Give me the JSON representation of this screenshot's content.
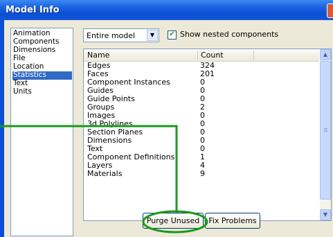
{
  "window": {
    "title": "Model Info"
  },
  "sidebar": {
    "items": [
      {
        "label": "Animation",
        "selected": false
      },
      {
        "label": "Components",
        "selected": false
      },
      {
        "label": "Dimensions",
        "selected": false
      },
      {
        "label": "File",
        "selected": false
      },
      {
        "label": "Location",
        "selected": false
      },
      {
        "label": "Statistics",
        "selected": true
      },
      {
        "label": "Text",
        "selected": false
      },
      {
        "label": "Units",
        "selected": false
      }
    ]
  },
  "scope": {
    "selected": "Entire model",
    "show_nested_label": "Show nested components",
    "show_nested_checked": true
  },
  "table": {
    "columns": [
      "Name",
      "Count"
    ],
    "rows": [
      [
        "Edges",
        "324"
      ],
      [
        "Faces",
        "201"
      ],
      [
        "Component Instances",
        "0"
      ],
      [
        "Guides",
        "0"
      ],
      [
        "Guide Points",
        "0"
      ],
      [
        "Groups",
        "2"
      ],
      [
        "Images",
        "0"
      ],
      [
        "3d Polylines",
        "0"
      ],
      [
        "Section Planes",
        "0"
      ],
      [
        "Dimensions",
        "0"
      ],
      [
        "Text",
        "0"
      ],
      [
        "Component Definitions",
        "1"
      ],
      [
        "Layers",
        "4"
      ],
      [
        "Materials",
        "9"
      ]
    ]
  },
  "buttons": {
    "purge_unused": "Purge Unused",
    "fix_problems": "Fix Problems"
  },
  "colors": {
    "title_bar": "#0b4fd4",
    "selection": "#316ac5",
    "highlight": "#1a9a1a"
  }
}
